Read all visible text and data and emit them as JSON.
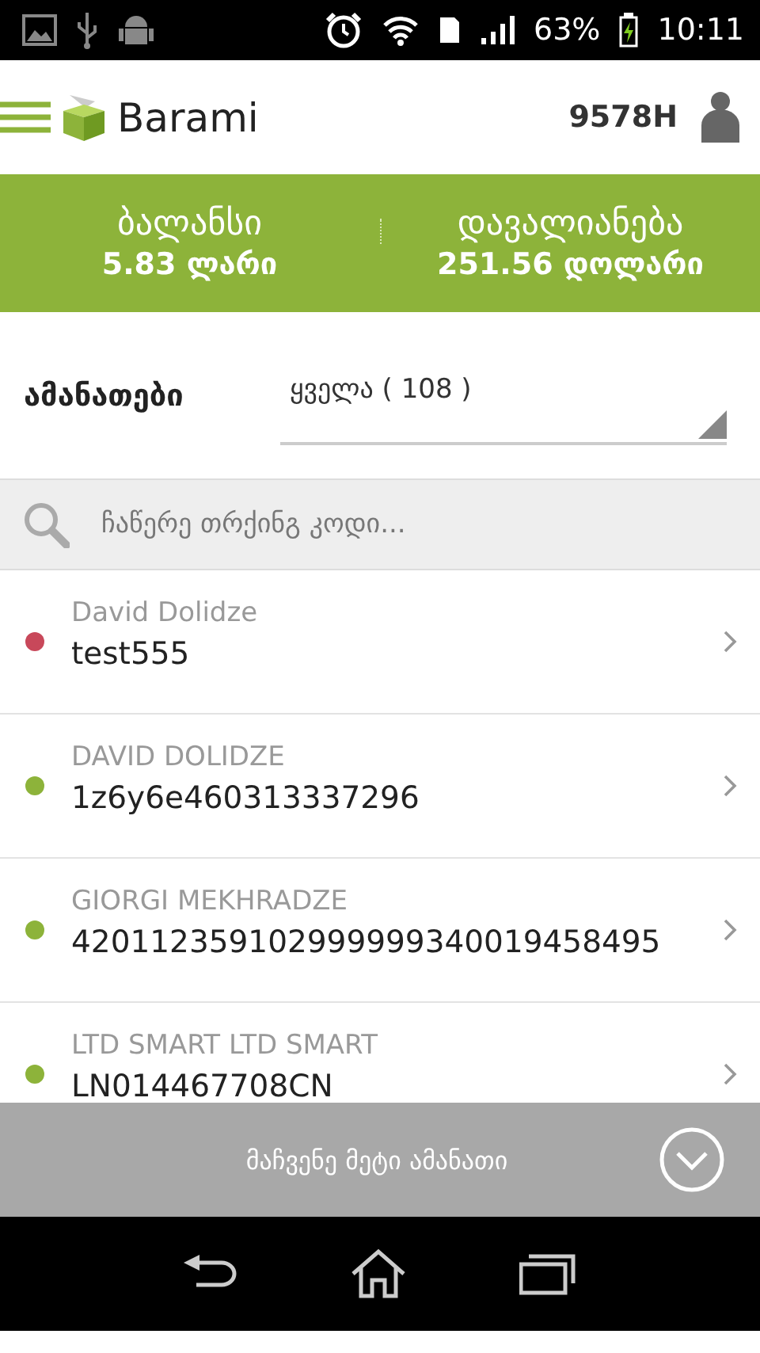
{
  "status_bar": {
    "battery": "63%",
    "time": "10:11"
  },
  "header": {
    "title": "Barami",
    "user_code": "9578H"
  },
  "summary": [
    {
      "label": "ბალანსი",
      "value": "5.83 ლარი"
    },
    {
      "label": "დავალიანება",
      "value": "251.56 დოლარი"
    }
  ],
  "filter": {
    "label": "ამანათები",
    "value": "ყველა ( 108 )"
  },
  "search": {
    "placeholder": "ჩაწერე თრქინგ კოდი..."
  },
  "parcels": [
    {
      "name": "David Dolidze",
      "code": "test555",
      "color": "#c8485a"
    },
    {
      "name": "DAVID DOLIDZE",
      "code": "1z6y6e460313337296",
      "color": "#8db33a"
    },
    {
      "name": "GIORGI MEKHRADZE",
      "code": "420112359102999999340019458495",
      "color": "#8db33a"
    },
    {
      "name": "LTD SMART LTD SMART",
      "code": "LN014467708CN",
      "color": "#8db33a"
    }
  ],
  "more_button": {
    "label": "მაჩვენე მეტი ამანათი"
  }
}
